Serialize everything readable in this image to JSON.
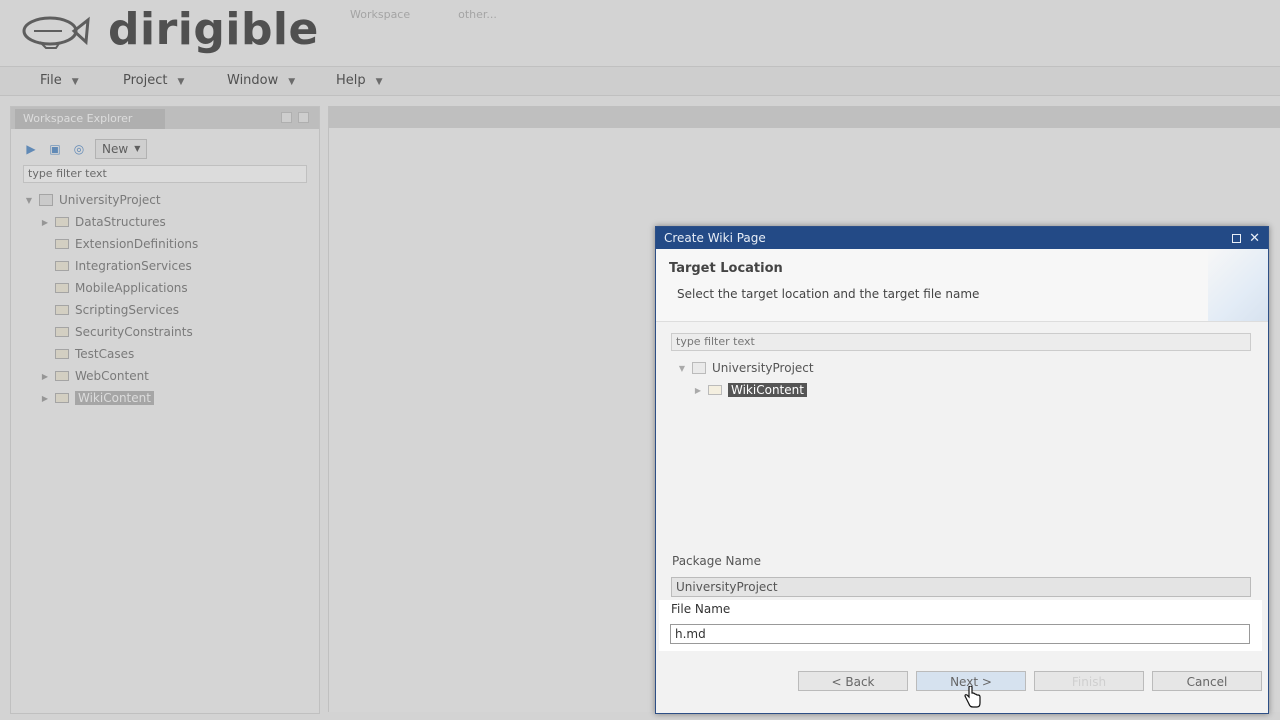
{
  "app": {
    "logo_text": "dirigible",
    "top_tabs": [
      "Workspace",
      "other..."
    ]
  },
  "menu": [
    {
      "label": "File"
    },
    {
      "label": "Project"
    },
    {
      "label": "Window"
    },
    {
      "label": "Help"
    }
  ],
  "explorer": {
    "title": "Workspace Explorer",
    "new_label": "New",
    "filter_placeholder": "type filter text",
    "project": "UniversityProject",
    "folders": [
      "DataStructures",
      "ExtensionDefinitions",
      "IntegrationServices",
      "MobileApplications",
      "ScriptingServices",
      "SecurityConstraints",
      "TestCases",
      "WebContent",
      "WikiContent"
    ],
    "selected": "WikiContent"
  },
  "dialog": {
    "title": "Create Wiki Page",
    "section_title": "Target Location",
    "description": "Select the target location and the target file name",
    "filter_placeholder": "type filter text",
    "tree": {
      "project": "UniversityProject",
      "selected_folder": "WikiContent"
    },
    "package_name_label": "Package Name",
    "package_name_value": "UniversityProject",
    "file_name_label": "File Name",
    "file_name_value": "h.md",
    "buttons": {
      "back": "< Back",
      "next": "Next >",
      "finish": "Finish",
      "cancel": "Cancel"
    }
  }
}
